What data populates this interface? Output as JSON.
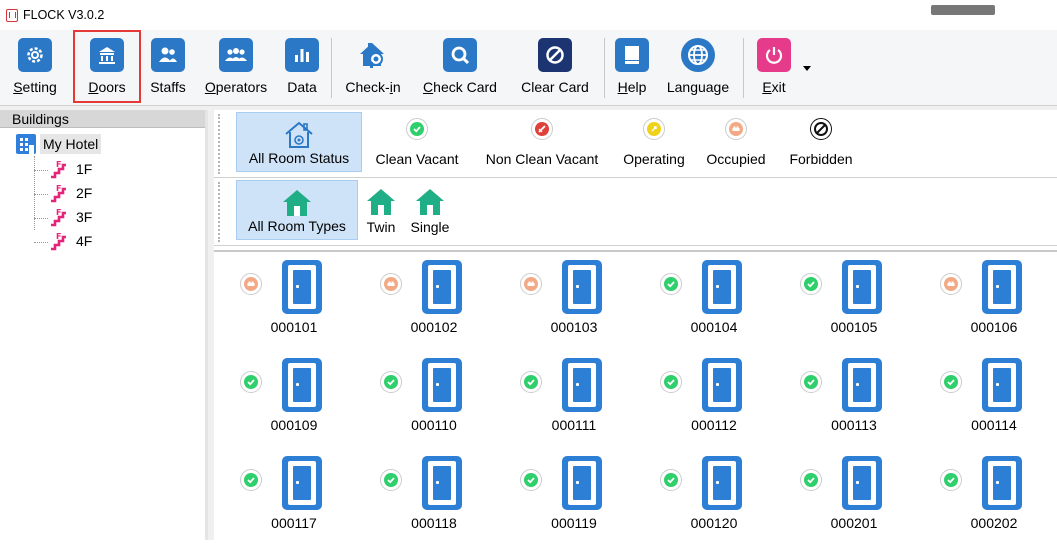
{
  "window": {
    "title": "FLOCK V3.0.2"
  },
  "toolbar": {
    "items": [
      {
        "label": "Setting",
        "mnemonic": "S",
        "rest": "etting",
        "icon": "gear-icon"
      },
      {
        "label": "Doors",
        "mnemonic": "D",
        "rest": "oors",
        "icon": "building-icon"
      },
      {
        "label": "Staffs",
        "mnemonic": "",
        "rest": "Staffs",
        "icon": "staff-icon"
      },
      {
        "label": "Operators",
        "mnemonic": "O",
        "rest": "perators",
        "icon": "operators-icon"
      },
      {
        "label": "Data",
        "mnemonic": "",
        "rest": "Data",
        "icon": "bar-chart-icon"
      },
      {
        "label": "Check-in",
        "pre": "Check-",
        "mnemonic": "i",
        "rest": "n",
        "icon": "house-key-icon"
      },
      {
        "label": "Check Card",
        "mnemonic": "C",
        "rest": "heck Card",
        "icon": "magnifier-icon"
      },
      {
        "label": "Clear Card",
        "mnemonic": "",
        "rest": "Clear Card",
        "icon": "no-entry-icon"
      },
      {
        "label": "Help",
        "mnemonic": "H",
        "rest": "elp",
        "icon": "book-icon"
      },
      {
        "label": "Language",
        "mnemonic": "",
        "rest": "Language",
        "icon": "globe-icon"
      },
      {
        "label": "Exit",
        "mnemonic": "E",
        "rest": "xit",
        "icon": "power-icon"
      }
    ]
  },
  "tree": {
    "header": "Buildings",
    "root": "My Hotel",
    "floors": [
      "1F",
      "2F",
      "3F",
      "4F"
    ]
  },
  "status_filters": [
    {
      "label": "All Room Status",
      "selected": true,
      "icon": "house-status-icon"
    },
    {
      "label": "Clean Vacant",
      "icon": "check-circle-icon",
      "color": "#2fcf6c"
    },
    {
      "label": "Non Clean Vacant",
      "icon": "broom-icon",
      "color": "#e0403a"
    },
    {
      "label": "Operating",
      "icon": "operating-icon",
      "color": "#f0d21a"
    },
    {
      "label": "Occupied",
      "icon": "bed-icon",
      "color": "#f4a986"
    },
    {
      "label": "Forbidden",
      "icon": "forbidden-icon",
      "color": "#111111"
    }
  ],
  "type_filters": [
    {
      "label": "All Room Types",
      "selected": true
    },
    {
      "label": "Twin"
    },
    {
      "label": "Single"
    }
  ],
  "colors": {
    "accent": "#2b78c6",
    "room_type": "#1fae86",
    "clean": "#2fcf6c",
    "occupied": "#f4a986"
  },
  "rooms": [
    {
      "number": "000101",
      "status": "occupied"
    },
    {
      "number": "000102",
      "status": "occupied"
    },
    {
      "number": "000103",
      "status": "occupied"
    },
    {
      "number": "000104",
      "status": "clean"
    },
    {
      "number": "000105",
      "status": "clean"
    },
    {
      "number": "000106",
      "status": "occupied"
    },
    {
      "number": "000109",
      "status": "clean"
    },
    {
      "number": "000110",
      "status": "clean"
    },
    {
      "number": "000111",
      "status": "clean"
    },
    {
      "number": "000112",
      "status": "clean"
    },
    {
      "number": "000113",
      "status": "clean"
    },
    {
      "number": "000114",
      "status": "clean"
    },
    {
      "number": "000117",
      "status": "clean"
    },
    {
      "number": "000118",
      "status": "clean"
    },
    {
      "number": "000119",
      "status": "clean"
    },
    {
      "number": "000120",
      "status": "clean"
    },
    {
      "number": "000201",
      "status": "clean"
    },
    {
      "number": "000202",
      "status": "clean"
    }
  ]
}
